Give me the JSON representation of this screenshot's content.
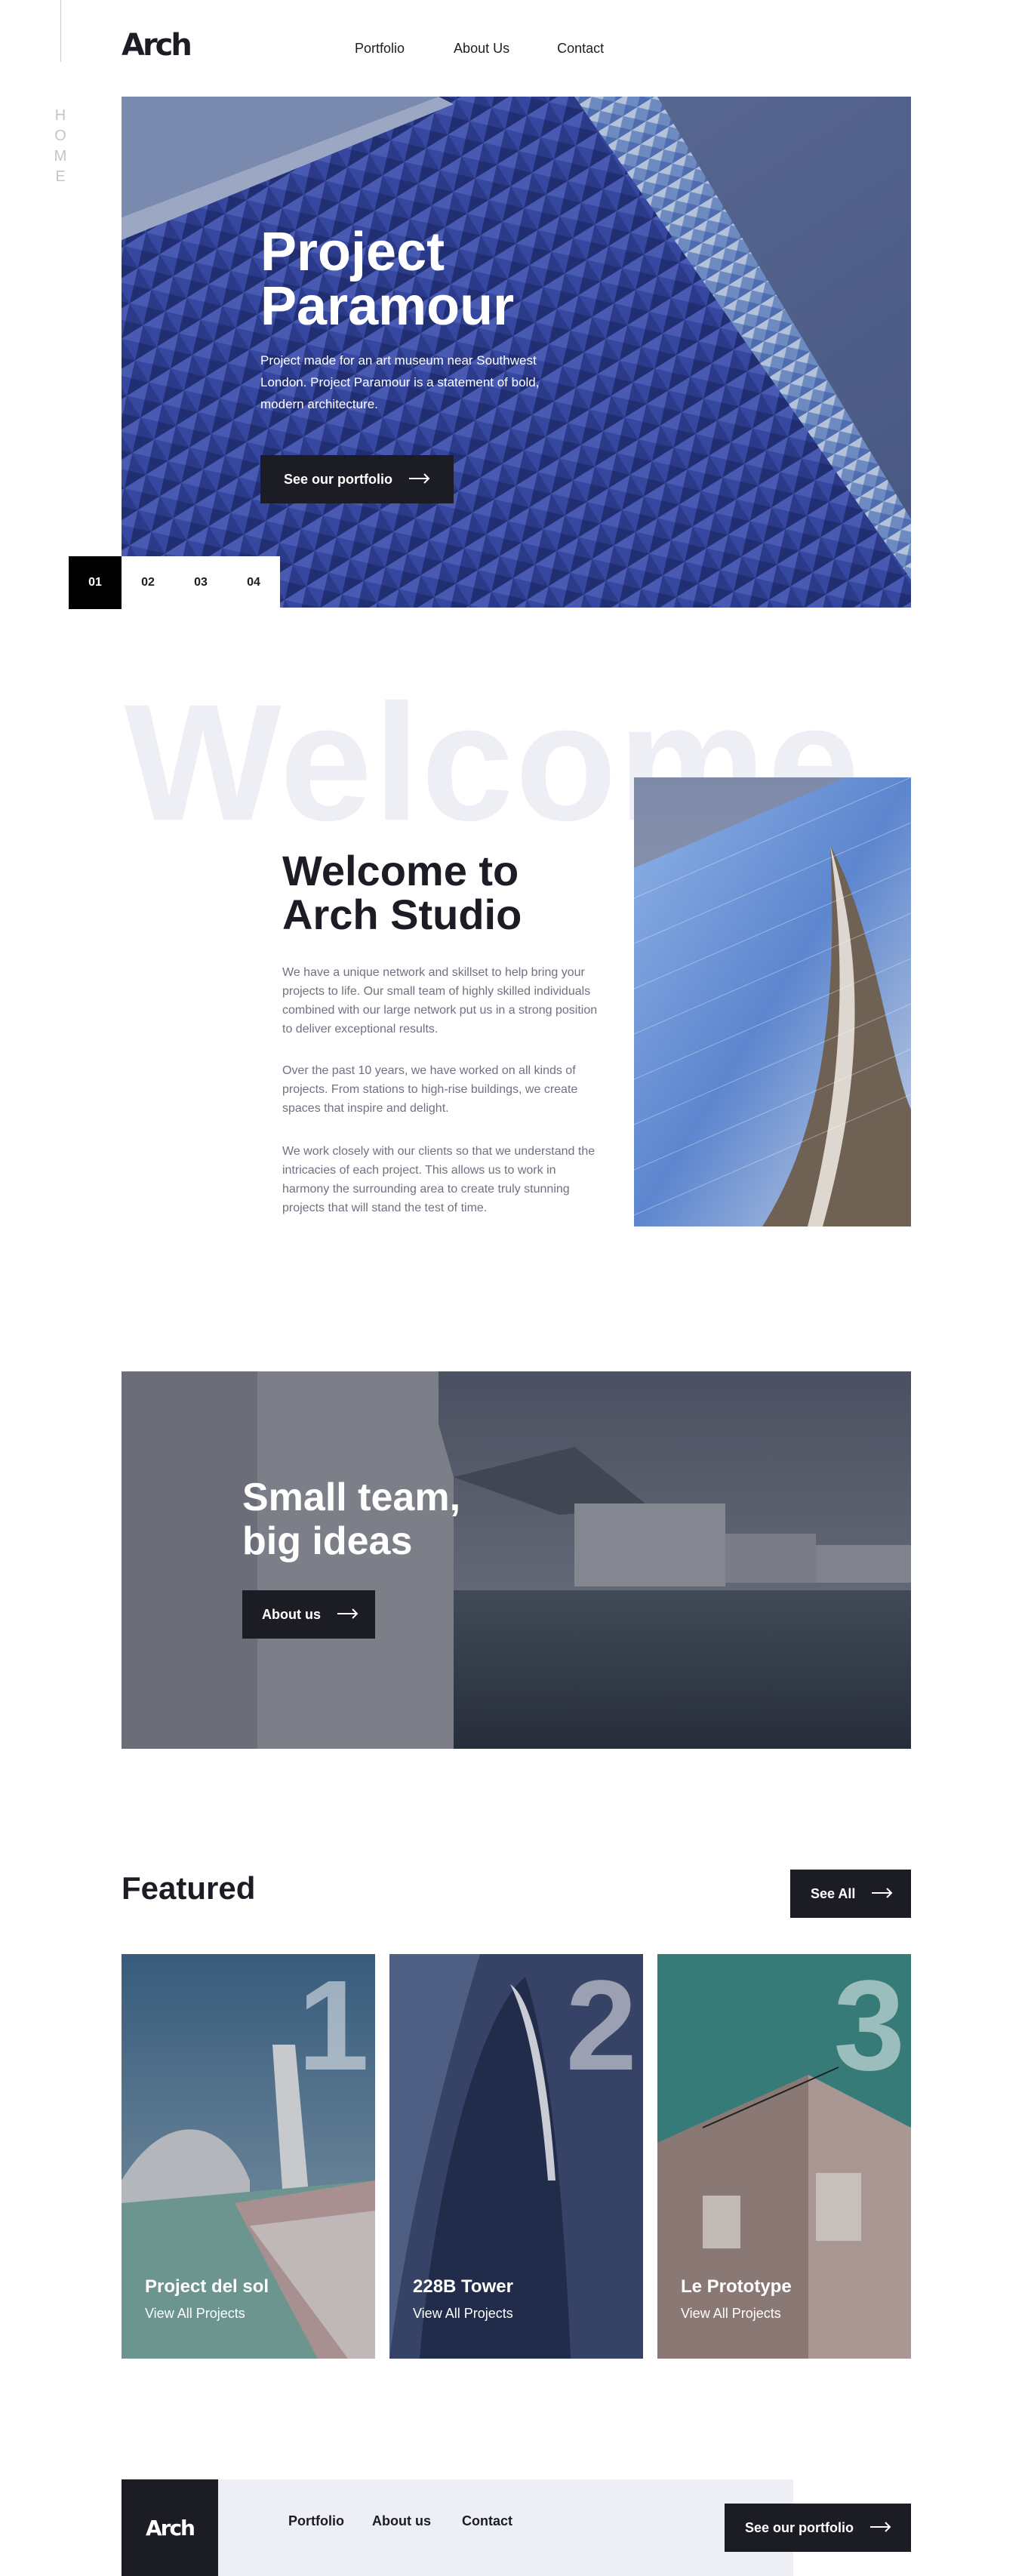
{
  "brand": {
    "logo": "Arch"
  },
  "side": {
    "letters": [
      "H",
      "O",
      "M",
      "E"
    ]
  },
  "nav": {
    "items": [
      "Portfolio",
      "About Us",
      "Contact"
    ]
  },
  "hero": {
    "title_line1": "Project",
    "title_line2": "Paramour",
    "description": "Project made for an art museum near Southwest London. Project Paramour is a statement of bold, modern architecture.",
    "button_label": "See our portfolio",
    "slides": [
      "01",
      "02",
      "03",
      "04"
    ],
    "active_slide": "01"
  },
  "welcome": {
    "background_word": "Welcome",
    "title_line1": "Welcome to",
    "title_line2": "Arch Studio",
    "paragraphs": [
      "We have a unique network and skillset to help bring your projects to life. Our small team of highly skilled individuals combined with our large network put us in a strong position to deliver exceptional results.",
      "Over the past 10 years, we have worked on all kinds of projects. From stations to high-rise buildings, we create spaces that inspire and delight.",
      "We work closely with our clients so that we understand the intricacies of each project. This allows us to work in harmony the surrounding area to create truly stunning projects that will stand the test of time."
    ]
  },
  "team": {
    "title_line1": "Small team,",
    "title_line2": "big ideas",
    "button_label": "About us"
  },
  "featured": {
    "title": "Featured",
    "see_all_label": "See All",
    "cards": [
      {
        "number": "1",
        "title": "Project del sol",
        "link": "View All Projects"
      },
      {
        "number": "2",
        "title": "228B Tower",
        "link": "View All Projects"
      },
      {
        "number": "3",
        "title": "Le Prototype",
        "link": "View All Projects"
      }
    ]
  },
  "footer": {
    "logo": "Arch",
    "nav": [
      "Portfolio",
      "About us",
      "Contact"
    ],
    "button_label": "See our portfolio"
  },
  "colors": {
    "dark": "#1c1d24",
    "light_gray_bg": "#eeeff4",
    "body_text": "#6e7281",
    "faint_text": "#c2c5d0"
  },
  "icons": {
    "button_arrow": "arrow-right-icon"
  }
}
